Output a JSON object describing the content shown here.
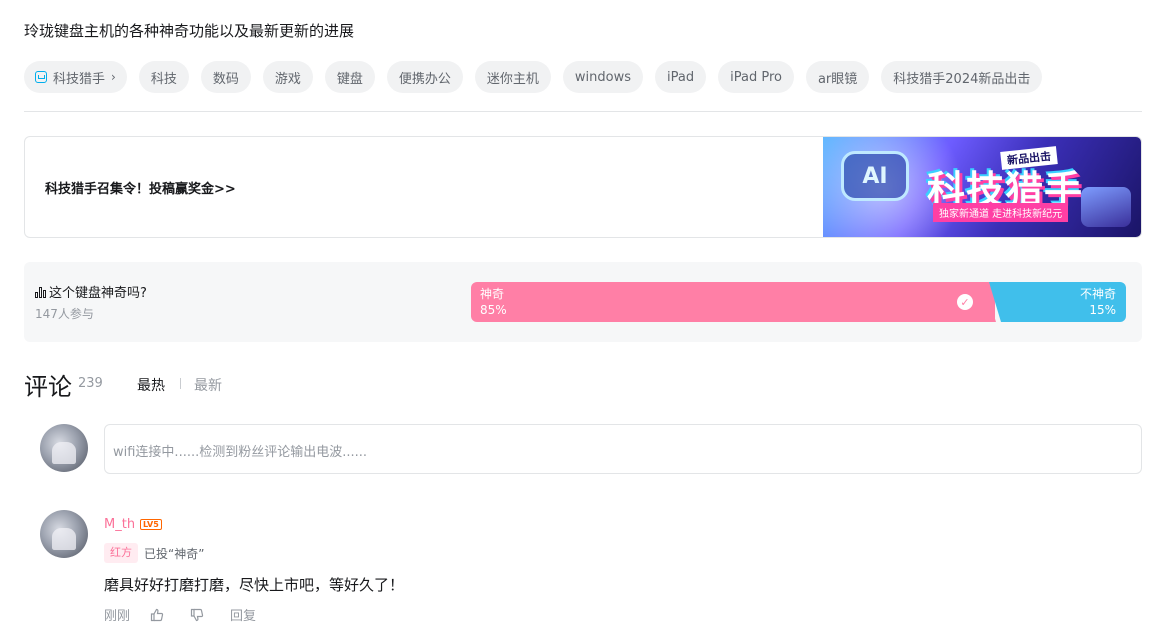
{
  "description": "玲珑键盘主机的各种神奇功能以及最新更新的进展",
  "tags": [
    "科技猎手",
    "科技",
    "数码",
    "游戏",
    "键盘",
    "便携办公",
    "迷你主机",
    "windows",
    "iPad",
    "iPad Pro",
    "ar眼镜",
    "科技猎手2024新品出击"
  ],
  "banner": {
    "text": "科技猎手召集令！投稿赢奖金>>",
    "image_texts": {
      "ai": "AI",
      "tagline_top": "新品出击",
      "brand": "科技猎手",
      "tagline_bottom": "独家新通道 走进科技新纪元"
    }
  },
  "vote": {
    "question": "这个键盘神奇吗?",
    "participants": "147人参与",
    "option_a": {
      "label": "神奇",
      "percent": "85%",
      "share": 0.85,
      "color": "#ff7fa6"
    },
    "option_b": {
      "label": "不神奇",
      "percent": "15%",
      "share": 0.15,
      "color": "#40bfeb"
    }
  },
  "comments_section": {
    "title": "评论",
    "count": "239",
    "sort_hot": "最热",
    "sort_new": "最新",
    "input_placeholder": "wifi连接中......检测到粉丝评论输出电波......"
  },
  "comment": {
    "username": "M_th",
    "level": "LV5",
    "side": "红方",
    "voted": "已投“神奇”",
    "text": "磨具好好打磨打磨，尽快上市吧，等好久了！",
    "time": "刚刚",
    "reply": "回复"
  },
  "colors": {
    "accent_pink": "#fb7299",
    "accent_blue": "#00aeec",
    "level_orange": "#ff6600"
  }
}
